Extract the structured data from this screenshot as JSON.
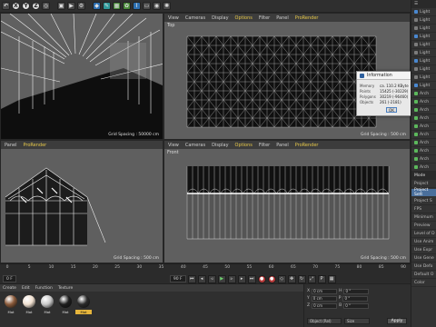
{
  "toolbar": {
    "axis_buttons": [
      "X",
      "Y",
      "Z"
    ]
  },
  "viewports": {
    "top_left": {
      "menu": [],
      "grid_spacing": "Grid Spacing : 50000 cm"
    },
    "top_right": {
      "name": "Top",
      "menu": [
        "View",
        "Cameras",
        "Display",
        "Options",
        "Filter",
        "Panel",
        "ProRender"
      ],
      "grid_spacing": "Grid Spacing : 500 cm"
    },
    "bottom_left": {
      "menu": [
        "Panel",
        "ProRender"
      ],
      "grid_spacing": "Grid Spacing : 500 cm"
    },
    "bottom_right": {
      "name": "Front",
      "menu": [
        "View",
        "Cameras",
        "Display",
        "Options",
        "Filter",
        "Panel",
        "ProRender"
      ],
      "grid_spacing": "Grid Spacing : 500 cm"
    },
    "top_left_menu_extra": [
      "View",
      "Cameras",
      "Display",
      "Options",
      "Filter",
      "Panel",
      "ProRender"
    ],
    "accent": "#e6c84a"
  },
  "info_dialog": {
    "title": "Information",
    "rows": [
      {
        "key": "Memory",
        "value": "ca. 110.2 KByte"
      },
      {
        "key": "Points",
        "value": "15425 (-30229)"
      },
      {
        "key": "Polygons",
        "value": "30219 (-96460)"
      },
      {
        "key": "Objects",
        "value": "261 (-2181)"
      }
    ],
    "ok_label": "OK"
  },
  "timeline": {
    "ticks": [
      "0",
      "5",
      "10",
      "15",
      "20",
      "25",
      "30",
      "35",
      "40",
      "45",
      "50",
      "55",
      "60",
      "65",
      "70",
      "75",
      "80",
      "85",
      "90"
    ],
    "start_frame": "0 F",
    "end_frame": "90 F"
  },
  "materials": {
    "menu": [
      "Create",
      "Edit",
      "Function",
      "Texture"
    ],
    "items": [
      {
        "label": "Mat",
        "color": "#8a5a3a"
      },
      {
        "label": "Mat",
        "color": "#f0e0d0"
      },
      {
        "label": "Mat",
        "color": "#c8c8c8"
      },
      {
        "label": "Mat",
        "color": "#1e1e1e"
      },
      {
        "label": "Mat",
        "color": "#2a2a2a",
        "selected": true
      }
    ]
  },
  "coordinates": {
    "rows": [
      {
        "axis": "X",
        "value": "0 cm",
        "axis2": "H",
        "value2": "0 °"
      },
      {
        "axis": "Y",
        "value": "0 cm",
        "axis2": "P",
        "value2": "0 °"
      },
      {
        "axis": "Z",
        "value": "0 cm",
        "axis2": "B",
        "value2": "0 °"
      }
    ],
    "mode_select": "Object (Rel)",
    "size_select": "Size",
    "apply_label": "Apply"
  },
  "right_panel": {
    "top_items": [
      "Light",
      "Light",
      "Light",
      "Light",
      "Light",
      "Light",
      "Light",
      "Light",
      "Light",
      "Light"
    ],
    "mid_items": [
      "Arch",
      "Arch",
      "Arch",
      "Arch",
      "Arch",
      "Arch",
      "Arch",
      "Arch",
      "Arch",
      "Arch"
    ],
    "mode_label": "Mode",
    "project_label": "Project",
    "project_tab": "Project Sett",
    "project_sub": "Project S",
    "props": [
      "FPS",
      "Minimum",
      "Preview",
      "Level of D",
      "Use Anim",
      "Use Expr",
      "Use Gene",
      "Use Defo",
      "Default O",
      "Color"
    ]
  }
}
